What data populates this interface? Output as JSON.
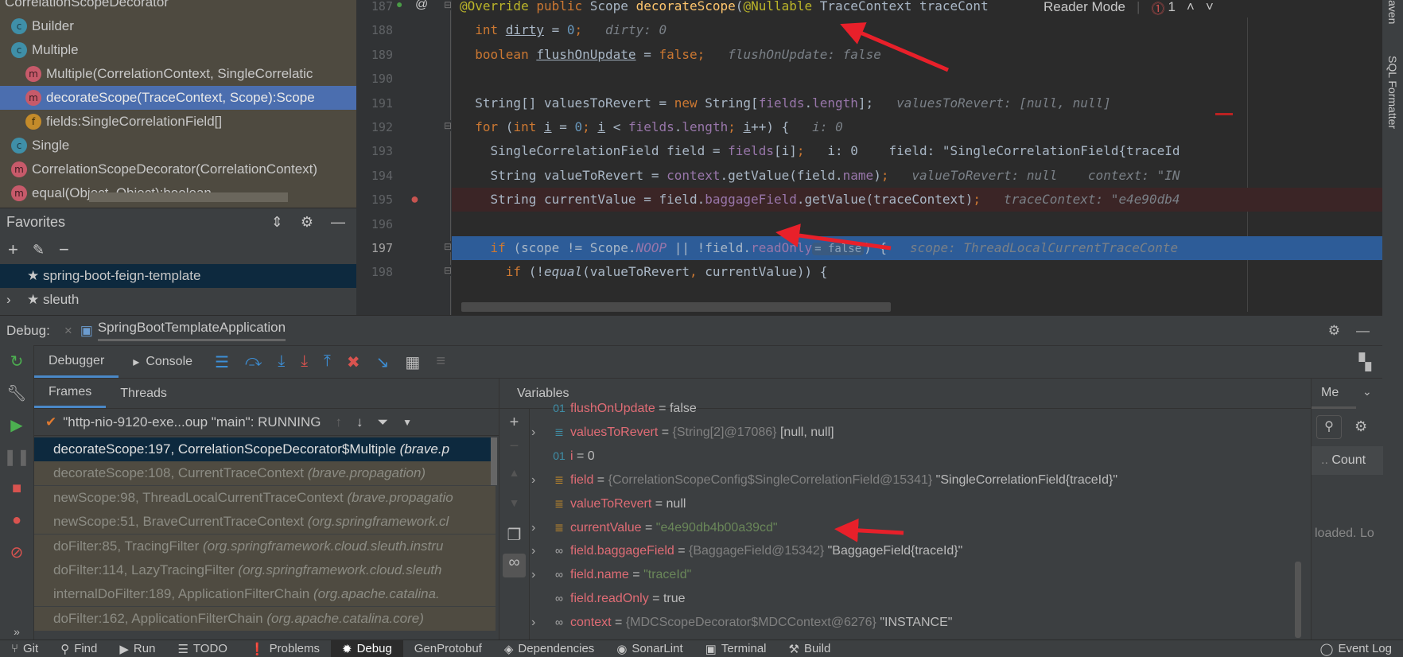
{
  "structure": {
    "tree_header": "CorrelationScopeDecorator",
    "items": [
      {
        "icon": "c",
        "label": "Builder",
        "indent": 0
      },
      {
        "icon": "c",
        "label": "Multiple",
        "indent": 0
      },
      {
        "icon": "m",
        "label": "Multiple(CorrelationContext, SingleCorrelatic",
        "indent": 1
      },
      {
        "icon": "m",
        "label": "decorateScope(TraceContext, Scope):Scope",
        "indent": 1,
        "selected": true
      },
      {
        "icon": "f",
        "label": "fields:SingleCorrelationField[]",
        "indent": 1
      },
      {
        "icon": "c",
        "label": "Single",
        "indent": 0
      },
      {
        "icon": "m",
        "label": "CorrelationScopeDecorator(CorrelationContext)",
        "indent": 0
      },
      {
        "icon": "m",
        "label": "equal(Object, Object):boolean",
        "indent": 0
      }
    ]
  },
  "favorites": {
    "title": "Favorites",
    "items": [
      {
        "label": "spring-boot-feign-template",
        "selected": true
      },
      {
        "label": "sleuth",
        "expandable": true
      }
    ]
  },
  "editor": {
    "reader_mode": "Reader Mode",
    "error_count": "1",
    "current_line": 197,
    "breakpoint_line": 195,
    "lines": [
      {
        "n": "187",
        "t": [
          [
            "@Override",
            "ann"
          ],
          [
            " public ",
            "kw"
          ],
          [
            "Scope ",
            ""
          ],
          [
            "decorateScope",
            "fn"
          ],
          [
            "(",
            ""
          ],
          [
            "@Nullable",
            "ann"
          ],
          [
            " TraceContext traceCont",
            ""
          ]
        ]
      },
      {
        "n": "188",
        "t": [
          [
            "  int ",
            "kw"
          ],
          [
            "dirty",
            "ul"
          ],
          [
            " = ",
            ""
          ],
          [
            "0",
            "num"
          ],
          [
            ";",
            "kw"
          ],
          [
            "   dirty: 0",
            "hint"
          ]
        ]
      },
      {
        "n": "189",
        "t": [
          [
            "  boolean ",
            "kw"
          ],
          [
            "flushOnUpdate",
            "ul"
          ],
          [
            " = ",
            ""
          ],
          [
            "false",
            "kw"
          ],
          [
            ";",
            "kw"
          ],
          [
            "   flushOnUpdate: false",
            "hint"
          ]
        ]
      },
      {
        "n": "190",
        "t": []
      },
      {
        "n": "191",
        "t": [
          [
            "  String[] valuesToRevert = ",
            ""
          ],
          [
            "new ",
            "kw"
          ],
          [
            "String[",
            ""
          ],
          [
            "fields",
            "fld"
          ],
          [
            ".",
            ""
          ],
          [
            "length",
            "fld"
          ],
          [
            "];",
            ""
          ],
          [
            "   valuesToRevert: [null, null]",
            "hint"
          ]
        ]
      },
      {
        "n": "192",
        "t": [
          [
            "  for ",
            "kw"
          ],
          [
            "(",
            ""
          ],
          [
            "int ",
            "kw"
          ],
          [
            "i",
            "ul"
          ],
          [
            " = ",
            ""
          ],
          [
            "0",
            "num"
          ],
          [
            "; ",
            "kw"
          ],
          [
            "i",
            "ul"
          ],
          [
            " < ",
            ""
          ],
          [
            "fields",
            "fld"
          ],
          [
            ".",
            ""
          ],
          [
            "length",
            "fld"
          ],
          [
            "; ",
            "kw"
          ],
          [
            "i",
            "ul"
          ],
          [
            "++) {",
            ""
          ],
          [
            "   i: 0",
            "hint"
          ]
        ]
      },
      {
        "n": "193",
        "t": [
          [
            "    SingleCorrelationField field = ",
            ""
          ],
          [
            "fields",
            "fld"
          ],
          [
            "[i]",
            ""
          ],
          [
            ";",
            "kw"
          ],
          [
            "   i: 0    field: \"SingleCorrelationField{traceId",
            ""
          ]
        ]
      },
      {
        "n": "194",
        "t": [
          [
            "    String valueToRevert = ",
            ""
          ],
          [
            "context",
            "fld"
          ],
          [
            ".getValue(field.",
            ""
          ],
          [
            "name",
            "fld"
          ],
          [
            ")",
            ""
          ],
          [
            ";",
            "kw"
          ],
          [
            "   valueToRevert: null    context: \"IN",
            "hint"
          ]
        ]
      },
      {
        "n": "195",
        "t": [
          [
            "    String currentValue = field.",
            ""
          ],
          [
            "baggageField",
            "fld"
          ],
          [
            ".getValue(traceContext)",
            ""
          ],
          [
            ";",
            "kw"
          ],
          [
            "   traceContext: \"e4e90db4",
            "hint"
          ]
        ]
      },
      {
        "n": "196",
        "t": []
      },
      {
        "n": "197",
        "t": [
          [
            "    if ",
            "kw"
          ],
          [
            "(scope != Scope.",
            ""
          ],
          [
            "NOOP",
            "fld it"
          ],
          [
            " || !field.",
            ""
          ],
          [
            "readOnly",
            "fld"
          ],
          [
            "= false",
            "badge"
          ],
          [
            ") {",
            ""
          ],
          [
            "   scope: ThreadLocalCurrentTraceConte",
            "hint"
          ]
        ]
      },
      {
        "n": "198",
        "t": [
          [
            "      if ",
            "kw"
          ],
          [
            "(!",
            ""
          ],
          [
            "equal",
            "it"
          ],
          [
            "(valueToRevert",
            ""
          ],
          [
            ", ",
            "kw"
          ],
          [
            "currentValue)) {",
            ""
          ]
        ]
      }
    ]
  },
  "right_strip": {
    "maven": "aven",
    "sql": "SQL Formatter"
  },
  "debug": {
    "label": "Debug:",
    "session": "SpringBootTemplateApplication",
    "tabs": [
      "Debugger",
      "Console"
    ],
    "subtabs": [
      "Frames",
      "Threads"
    ],
    "variables_title": "Variables",
    "memory_tab": "Me",
    "memory_count": "Count",
    "memory_status": "loaded. Lo",
    "thread": "\"http-nio-9120-exe...oup \"main\": RUNNING",
    "frames": [
      [
        "decorateScope:197, CorrelationScopeDecorator$Multiple ",
        "(brave.p"
      ],
      [
        "decorateScope:108, CurrentTraceContext ",
        "(brave.propagation)"
      ],
      [
        "newScope:98, ThreadLocalCurrentTraceContext ",
        "(brave.propagatio"
      ],
      [
        "newScope:51, BraveCurrentTraceContext ",
        "(org.springframework.cl"
      ],
      [
        "doFilter:85, TracingFilter ",
        "(org.springframework.cloud.sleuth.instru"
      ],
      [
        "doFilter:114, LazyTracingFilter ",
        "(org.springframework.cloud.sleuth"
      ],
      [
        "internalDoFilter:189, ApplicationFilterChain ",
        "(org.apache.catalina."
      ],
      [
        "doFilter:162, ApplicationFilterChain ",
        "(org.apache.catalina.core)"
      ]
    ],
    "variables": [
      {
        "icon": "01",
        "name": "flushOnUpdate",
        "val": "false",
        "partial": true
      },
      {
        "icon": "arr",
        "name": "valuesToRevert",
        "ref": "{String[2]@17086}",
        "val": "[null, null]",
        "exp": true
      },
      {
        "icon": "01",
        "name": "i",
        "val": "0"
      },
      {
        "icon": "obj",
        "name": "field",
        "ref": "{CorrelationScopeConfig$SingleCorrelationField@15341}",
        "val": "\"SingleCorrelationField{traceId}\"",
        "exp": true
      },
      {
        "icon": "obj",
        "name": "valueToRevert",
        "val": "null"
      },
      {
        "icon": "obj",
        "name": "currentValue",
        "str": "\"e4e90db4b00a39cd\"",
        "exp": true
      },
      {
        "icon": "watch",
        "name": "field.baggageField",
        "ref": "{BaggageField@15342}",
        "val": "\"BaggageField{traceId}\"",
        "exp": true
      },
      {
        "icon": "watch",
        "name": "field.name",
        "str": "\"traceId\"",
        "exp": true
      },
      {
        "icon": "watch",
        "name": "field.readOnly",
        "val": "true"
      },
      {
        "icon": "watch",
        "name": "context",
        "ref": "{MDCScopeDecorator$MDCContext@6276}",
        "val": "\"INSTANCE\"",
        "exp": true
      }
    ]
  },
  "bottom": {
    "items": [
      "Git",
      "Find",
      "Run",
      "TODO",
      "Problems",
      "Debug",
      "GenProtobuf",
      "Dependencies",
      "SonarLint",
      "Terminal",
      "Build"
    ],
    "active": "Debug",
    "event_log": "Event Log"
  },
  "colors": {
    "annotation_arrow": "#e8202a",
    "exec_line": "#2d5c98",
    "selection": "#4b6eaf"
  }
}
